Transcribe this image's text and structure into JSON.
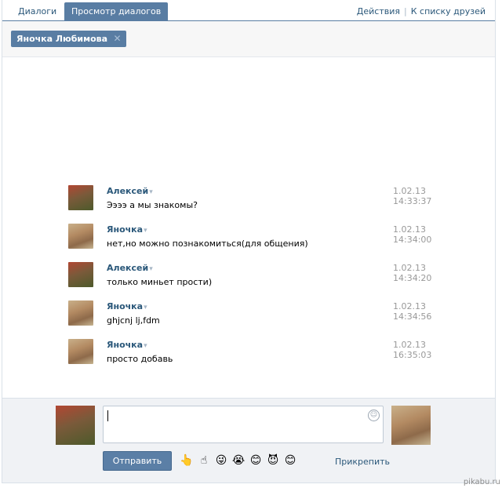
{
  "tabs": [
    {
      "label": "Диалоги",
      "active": false
    },
    {
      "label": "Просмотр диалогов",
      "active": true
    }
  ],
  "top_actions": {
    "actions": "Действия",
    "separator": "|",
    "friends": "К списку друзей"
  },
  "recipient": {
    "name": "Яночка Любимова",
    "remove_icon": "close-icon"
  },
  "messages": [
    {
      "author": "Алексей",
      "text": "Ээээ а мы знакомы?",
      "date": "1.02.13",
      "time": "14:33:37",
      "avatar": "alexey"
    },
    {
      "author": "Яночка",
      "text": "нет,но можно познакомиться(для общения)",
      "date": "1.02.13",
      "time": "14:34:00",
      "avatar": "yanochka"
    },
    {
      "author": "Алексей",
      "text": "только миньет прости)",
      "date": "1.02.13",
      "time": "14:34:20",
      "avatar": "alexey"
    },
    {
      "author": "Яночка",
      "text": "ghjcnj lj,fdm",
      "date": "1.02.13",
      "time": "14:34:56",
      "avatar": "yanochka"
    },
    {
      "author": "Яночка",
      "text": "просто добавь",
      "date": "1.02.13",
      "time": "16:35:03",
      "avatar": "yanochka"
    }
  ],
  "author_caret": "▾",
  "composer": {
    "input_value": "",
    "send_label": "Отправить",
    "attach_label": "Прикрепить",
    "smile_icon": "smiley-icon",
    "emojis": [
      "👆",
      "☝",
      "😜",
      "😭",
      "😊",
      "😈",
      "😊"
    ]
  },
  "watermark": "pikabu.ru",
  "colors": {
    "accent": "#597da3",
    "link": "#2b587a",
    "timestamp": "#999999",
    "composer_bg": "#f0f2f5"
  }
}
